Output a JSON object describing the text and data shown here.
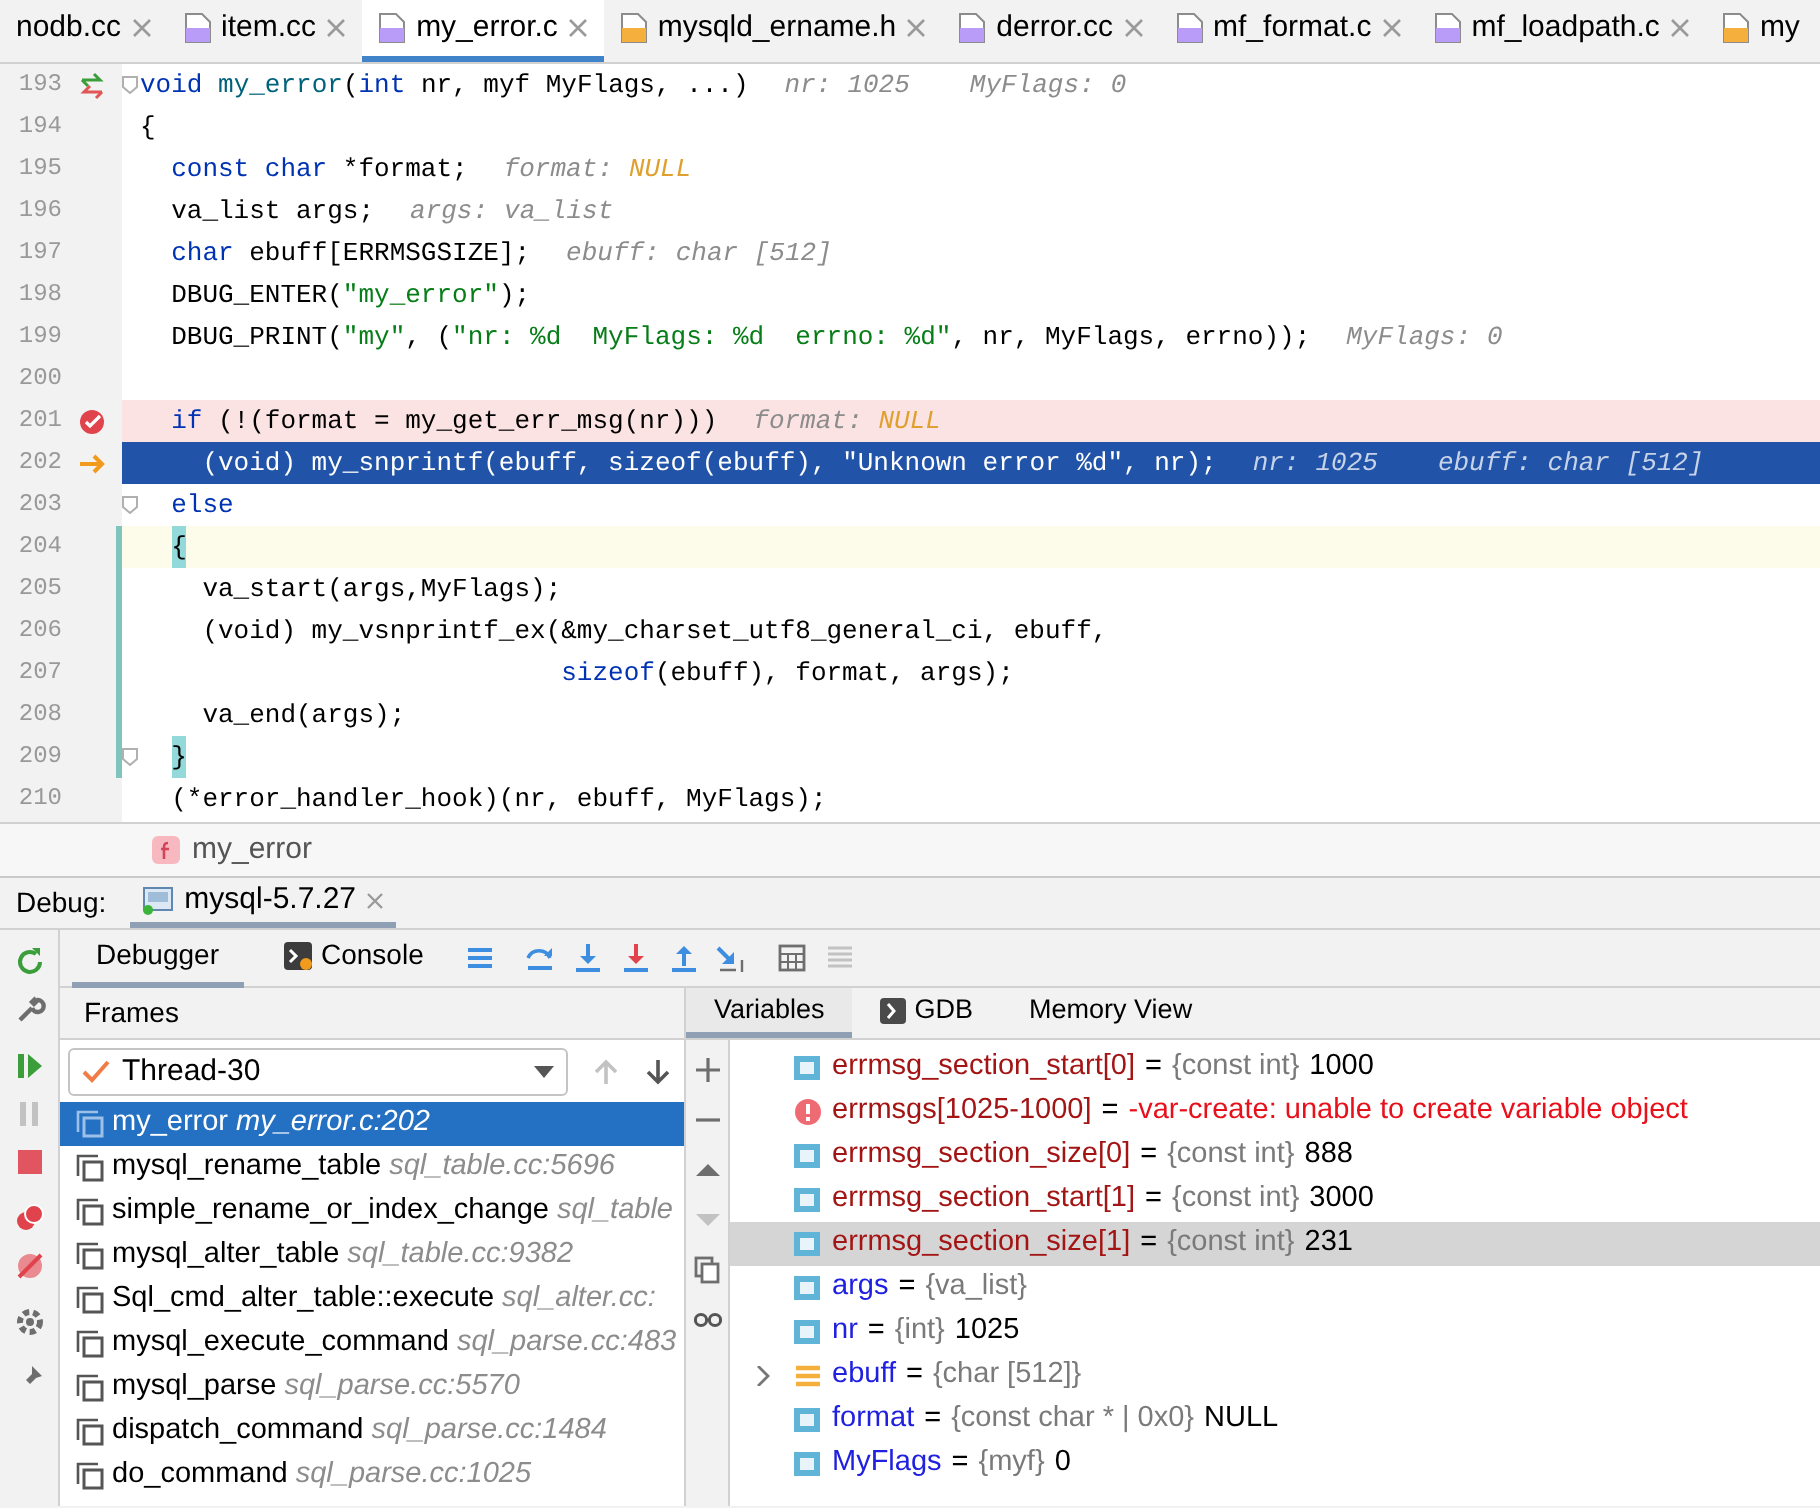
{
  "file_tabs": [
    {
      "label": "nodb.cc",
      "selected": false,
      "close_button": true
    },
    {
      "label": "item.cc",
      "kind": "cpp",
      "selected": false,
      "close_button": true
    },
    {
      "label": "my_error.c",
      "kind": "c",
      "selected": true,
      "close_button": true
    },
    {
      "label": "mysqld_ername.h",
      "kind": "h",
      "selected": false,
      "close_button": true
    },
    {
      "label": "derror.cc",
      "kind": "cpp",
      "selected": false,
      "close_button": true
    },
    {
      "label": "mf_format.c",
      "kind": "c",
      "selected": false,
      "close_button": true
    },
    {
      "label": "mf_loadpath.c",
      "kind": "c",
      "selected": false,
      "close_button": true
    },
    {
      "label": "my",
      "kind": "h",
      "selected": false,
      "close_button": false
    }
  ],
  "editor": {
    "lines": [
      {
        "number": "193",
        "kind": "step",
        "fold": true,
        "changed": false,
        "tokens": [
          {
            "kind": "kw",
            "t": "void"
          },
          {
            "kind": "decl",
            "t": " my_error"
          },
          {
            "kind": "p",
            "t": "("
          },
          {
            "kind": "kw",
            "t": "int"
          },
          {
            "kind": "p",
            "t": " nr, myf MyFlags, ...)"
          }
        ],
        "hints": [
          {
            "label": "nr:",
            "value": "1025",
            "kind": "plain"
          },
          {
            "label": "MyFlags:",
            "value": "0",
            "kind": "plain"
          }
        ]
      },
      {
        "number": "194",
        "kind": "plain",
        "fold": false,
        "changed": false,
        "tokens": [
          {
            "kind": "p",
            "t": "{"
          }
        ]
      },
      {
        "number": "195",
        "kind": "plain",
        "fold": false,
        "changed": false,
        "tokens": [
          {
            "kind": "kw",
            "t": "  const char"
          },
          {
            "kind": "p",
            "t": " *format;"
          }
        ],
        "hints": [
          {
            "label": "format:",
            "value": "NULL",
            "kind": "null"
          }
        ]
      },
      {
        "number": "196",
        "kind": "plain",
        "fold": false,
        "changed": false,
        "tokens": [
          {
            "kind": "p",
            "t": "  va_list args;"
          }
        ],
        "hints": [
          {
            "label": "args:",
            "value": "va_list",
            "kind": "plain"
          }
        ]
      },
      {
        "number": "197",
        "kind": "plain",
        "fold": false,
        "changed": false,
        "tokens": [
          {
            "kind": "kw",
            "t": "  char"
          },
          {
            "kind": "p",
            "t": " ebuff[ERRMSGSIZE];"
          }
        ],
        "hints": [
          {
            "label": "ebuff:",
            "value": "char [512]",
            "kind": "plain"
          }
        ]
      },
      {
        "number": "198",
        "kind": "plain",
        "fold": false,
        "changed": false,
        "tokens": [
          {
            "kind": "p",
            "t": "  DBUG_ENTER("
          },
          {
            "kind": "str",
            "t": "\"my_error\""
          },
          {
            "kind": "p",
            "t": ");"
          }
        ]
      },
      {
        "number": "199",
        "kind": "plain",
        "fold": false,
        "changed": false,
        "tokens": [
          {
            "kind": "p",
            "t": "  DBUG_PRINT("
          },
          {
            "kind": "str",
            "t": "\"my\""
          },
          {
            "kind": "p",
            "t": ", ("
          },
          {
            "kind": "str",
            "t": "\"nr: %d  MyFlags: %d  errno: %d\""
          },
          {
            "kind": "p",
            "t": ", nr, MyFlags, errno));"
          }
        ],
        "hints": [
          {
            "label": "MyFlags:",
            "value": "0",
            "kind": "plain"
          }
        ]
      },
      {
        "number": "200",
        "kind": "plain",
        "fold": false,
        "changed": false
      },
      {
        "number": "201",
        "kind": "breakpoint",
        "fold": false,
        "changed": false,
        "tokens": [
          {
            "kind": "kw",
            "t": "  if"
          },
          {
            "kind": "p",
            "t": " (!(format = my_get_err_msg(nr)))"
          }
        ],
        "hints": [
          {
            "label": "format:",
            "value": "NULL",
            "kind": "null"
          }
        ]
      },
      {
        "number": "202",
        "kind": "current",
        "fold": false,
        "changed": false,
        "tokens": [
          {
            "kind": "p",
            "t": "    (void) my_snprintf(ebuff, "
          },
          {
            "kind": "kw",
            "t": "sizeof"
          },
          {
            "kind": "p",
            "t": "(ebuff), "
          },
          {
            "kind": "str",
            "t": "\"Unknown error %d\""
          },
          {
            "kind": "p",
            "t": ", nr);"
          }
        ],
        "hints": [
          {
            "label": "nr:",
            "value": "1025",
            "kind": "plain"
          },
          {
            "label": "ebuff:",
            "value": "char [512]",
            "kind": "plain"
          }
        ]
      },
      {
        "number": "203",
        "kind": "plain",
        "fold": true,
        "changed": false,
        "tokens": [
          {
            "kind": "kw",
            "t": "  else"
          }
        ]
      },
      {
        "number": "204",
        "kind": "caret",
        "fold": false,
        "changed": true,
        "tokens": [
          {
            "kind": "brace",
            "t": "  {"
          }
        ]
      },
      {
        "number": "205",
        "kind": "plain",
        "fold": false,
        "changed": true,
        "tokens": [
          {
            "kind": "p",
            "t": "    va_start(args,MyFlags);"
          }
        ]
      },
      {
        "number": "206",
        "kind": "plain",
        "fold": false,
        "changed": true,
        "tokens": [
          {
            "kind": "p",
            "t": "    (void) my_vsnprintf_ex(&my_charset_utf8_general_ci, ebuff,"
          }
        ]
      },
      {
        "number": "207",
        "kind": "plain",
        "fold": false,
        "changed": true,
        "tokens": [
          {
            "kind": "kw",
            "t": "                           sizeof"
          },
          {
            "kind": "p",
            "t": "(ebuff), format, args);"
          }
        ]
      },
      {
        "number": "208",
        "kind": "plain",
        "fold": false,
        "changed": true,
        "tokens": [
          {
            "kind": "p",
            "t": "    va_end(args);"
          }
        ]
      },
      {
        "number": "209",
        "kind": "plain",
        "fold": true,
        "changed": true,
        "tokens": [
          {
            "kind": "brace",
            "t": "  }"
          }
        ]
      },
      {
        "number": "210",
        "kind": "plain",
        "fold": false,
        "changed": false,
        "tokens": [
          {
            "kind": "p",
            "t": "  (*error_handler_hook)(nr, ebuff, MyFlags);"
          }
        ]
      }
    ]
  },
  "breadcrumb": "my_error",
  "debug": {
    "label": "Debug:",
    "session": "mysql-5.7.27",
    "tabs": [
      {
        "label": "Debugger",
        "selected": true
      },
      {
        "label": "Console",
        "selected": false
      }
    ],
    "frames": {
      "title": "Frames",
      "thread": "Thread-30",
      "items": [
        {
          "function": "my_error",
          "location": "my_error.c:202",
          "selected": true
        },
        {
          "function": "mysql_rename_table",
          "location": "sql_table.cc:5696",
          "selected": false
        },
        {
          "function": "simple_rename_or_index_change",
          "location": "sql_table",
          "selected": false
        },
        {
          "function": "mysql_alter_table",
          "location": "sql_table.cc:9382",
          "selected": false
        },
        {
          "function": "Sql_cmd_alter_table::execute",
          "location": "sql_alter.cc:",
          "selected": false
        },
        {
          "function": "mysql_execute_command",
          "location": "sql_parse.cc:483",
          "selected": false
        },
        {
          "function": "mysql_parse",
          "location": "sql_parse.cc:5570",
          "selected": false
        },
        {
          "function": "dispatch_command",
          "location": "sql_parse.cc:1484",
          "selected": false
        },
        {
          "function": "do_command",
          "location": "sql_parse.cc:1025",
          "selected": false
        }
      ]
    },
    "variable_tabs": [
      {
        "label": "Variables",
        "selected": true
      },
      {
        "label": "GDB",
        "selected": false
      },
      {
        "label": "Memory View",
        "selected": false
      }
    ],
    "variables": [
      {
        "kind": "field",
        "watch": true,
        "name": "errmsg_section_start[0]",
        "sep": "=",
        "type": "{const int}",
        "value": "1000",
        "selected": false
      },
      {
        "kind": "error",
        "watch": true,
        "name": "errmsgs[1025-1000]",
        "sep": "=",
        "error": "-var-create: unable to create variable object",
        "selected": false
      },
      {
        "kind": "field",
        "watch": true,
        "name": "errmsg_section_size[0]",
        "sep": "=",
        "type": "{const int}",
        "value": "888",
        "selected": false
      },
      {
        "kind": "field",
        "watch": true,
        "name": "errmsg_section_start[1]",
        "sep": "=",
        "type": "{const int}",
        "value": "3000",
        "selected": false
      },
      {
        "kind": "field",
        "watch": true,
        "name": "errmsg_section_size[1]",
        "sep": "=",
        "type": "{const int}",
        "value": "231",
        "selected": true
      },
      {
        "kind": "field",
        "watch": false,
        "name": "args",
        "sep": "=",
        "type": "{va_list}",
        "selected": false
      },
      {
        "kind": "field",
        "watch": false,
        "name": "nr",
        "sep": "=",
        "type": "{int}",
        "value": "1025",
        "selected": false
      },
      {
        "kind": "array",
        "watch": false,
        "name": "ebuff",
        "sep": "=",
        "type": "{char [512]}",
        "expanded": false,
        "selected": false
      },
      {
        "kind": "field",
        "watch": false,
        "name": "format",
        "sep": "=",
        "type": "{const char * | 0x0}",
        "value": "NULL",
        "selected": false
      },
      {
        "kind": "field",
        "watch": false,
        "name": "MyFlags",
        "sep": "=",
        "type": "{myf}",
        "value": "0",
        "selected": false
      }
    ]
  }
}
